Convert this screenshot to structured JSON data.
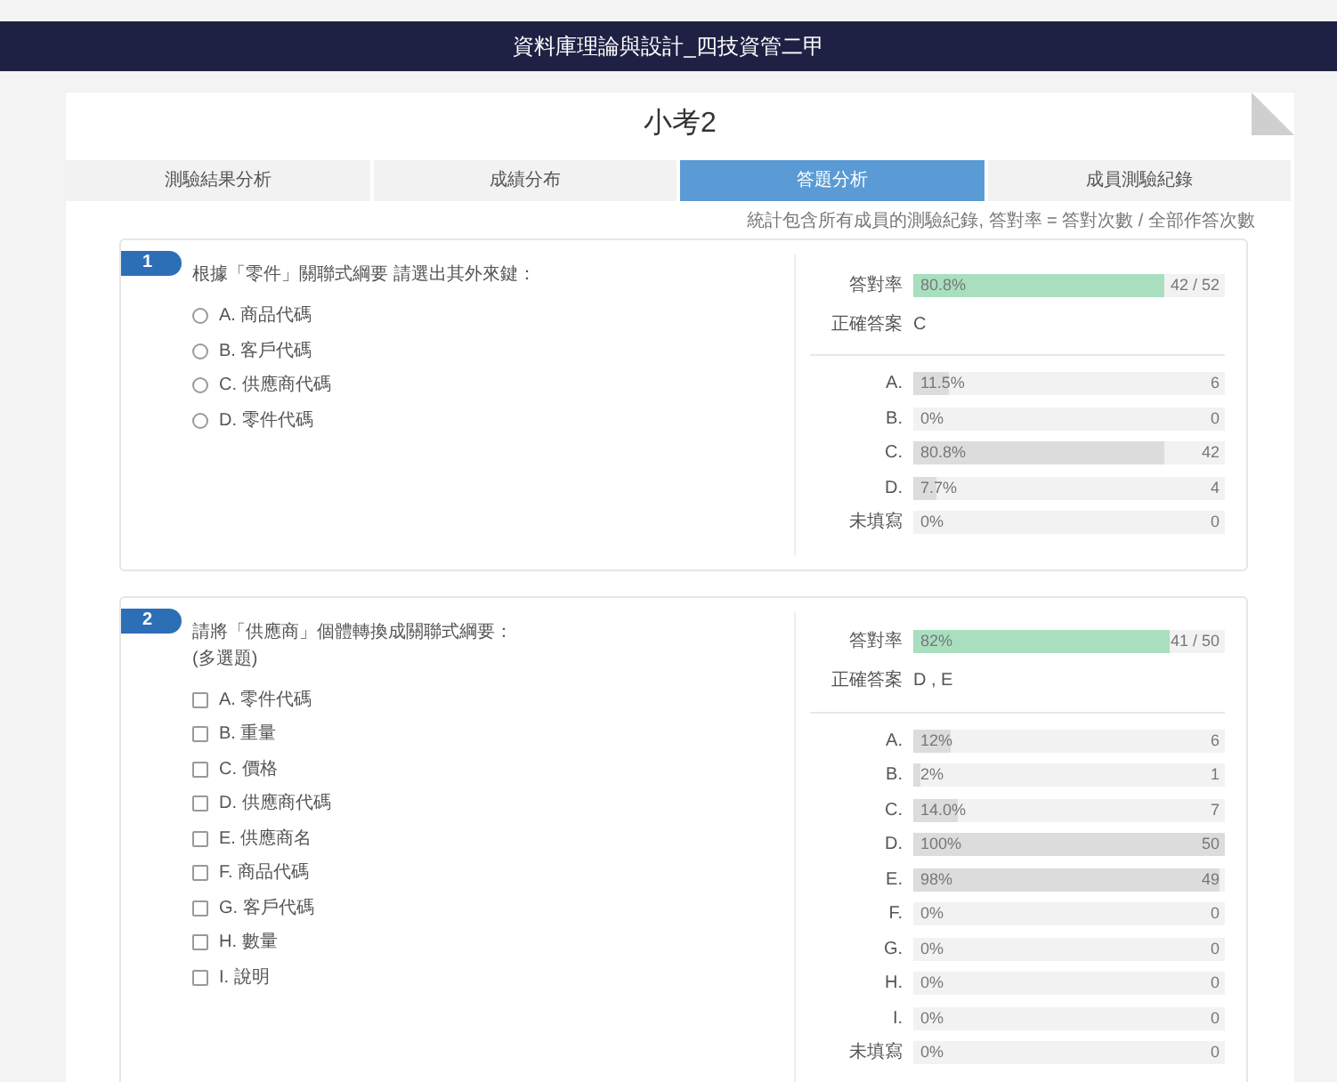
{
  "header": {
    "title": "資料庫理論與設計_四技資管二甲"
  },
  "page_title": "小考2",
  "tabs": [
    {
      "label": "測驗結果分析",
      "selected": false
    },
    {
      "label": "成績分布",
      "selected": false
    },
    {
      "label": "答題分析",
      "selected": true
    },
    {
      "label": "成員測驗紀錄",
      "selected": false
    }
  ],
  "note": "統計包含所有成員的測驗紀錄, 答對率 = 答對次數 / 全部作答次數",
  "questions": [
    {
      "number": "1",
      "kind": "single",
      "text": [
        "根據「零件」關聯式綱要 請選出其外來鍵："
      ],
      "options": [
        {
          "label": "A. 商品代碼",
          "checked": false
        },
        {
          "label": "B. 客戶代碼",
          "checked": false
        },
        {
          "label": "C. 供應商代碼",
          "checked": false
        },
        {
          "label": "D. 零件代碼",
          "checked": false
        }
      ],
      "rate": {
        "label": "答對率",
        "text": "80.8%",
        "level": 0.808,
        "count": "42 / 52"
      },
      "answer": {
        "label": "正確答案",
        "value": "C"
      },
      "stats": [
        {
          "label": "A.",
          "text": "11.5%",
          "level": 0.115,
          "count": "6"
        },
        {
          "label": "B.",
          "text": "0%",
          "level": 0,
          "count": "0"
        },
        {
          "label": "C.",
          "text": "80.8%",
          "level": 0.808,
          "count": "42"
        },
        {
          "label": "D.",
          "text": "7.7%",
          "level": 0.077,
          "count": "4"
        },
        {
          "label": "未填寫",
          "text": "0%",
          "level": 0,
          "count": "0"
        }
      ]
    },
    {
      "number": "2",
      "kind": "multiple",
      "text": [
        "請將「供應商」個體轉換成關聯式綱要：",
        "(多選題)"
      ],
      "options": [
        {
          "label": "A. 零件代碼",
          "checked": false
        },
        {
          "label": "B. 重量",
          "checked": false
        },
        {
          "label": "C. 價格",
          "checked": false
        },
        {
          "label": "D. 供應商代碼",
          "checked": false
        },
        {
          "label": "E. 供應商名",
          "checked": false
        },
        {
          "label": "F. 商品代碼",
          "checked": false
        },
        {
          "label": "G. 客戶代碼",
          "checked": false
        },
        {
          "label": "H. 數量",
          "checked": false
        },
        {
          "label": "I. 說明",
          "checked": false
        }
      ],
      "rate": {
        "label": "答對率",
        "text": "82%",
        "level": 0.82,
        "count": "41 / 50"
      },
      "answer": {
        "label": "正確答案",
        "value": "D , E"
      },
      "stats": [
        {
          "label": "A.",
          "text": "12%",
          "level": 0.12,
          "count": "6"
        },
        {
          "label": "B.",
          "text": "2%",
          "level": 0.02,
          "count": "1"
        },
        {
          "label": "C.",
          "text": "14.0%",
          "level": 0.14,
          "count": "7"
        },
        {
          "label": "D.",
          "text": "100%",
          "level": 1,
          "count": "50"
        },
        {
          "label": "E.",
          "text": "98%",
          "level": 0.98,
          "count": "49"
        },
        {
          "label": "F.",
          "text": "0%",
          "level": 0,
          "count": "0"
        },
        {
          "label": "G.",
          "text": "0%",
          "level": 0,
          "count": "0"
        },
        {
          "label": "H.",
          "text": "0%",
          "level": 0,
          "count": "0"
        },
        {
          "label": "I.",
          "text": "0%",
          "level": 0,
          "count": "0"
        },
        {
          "label": "未填寫",
          "text": "0%",
          "level": 0,
          "count": "0"
        }
      ]
    }
  ]
}
